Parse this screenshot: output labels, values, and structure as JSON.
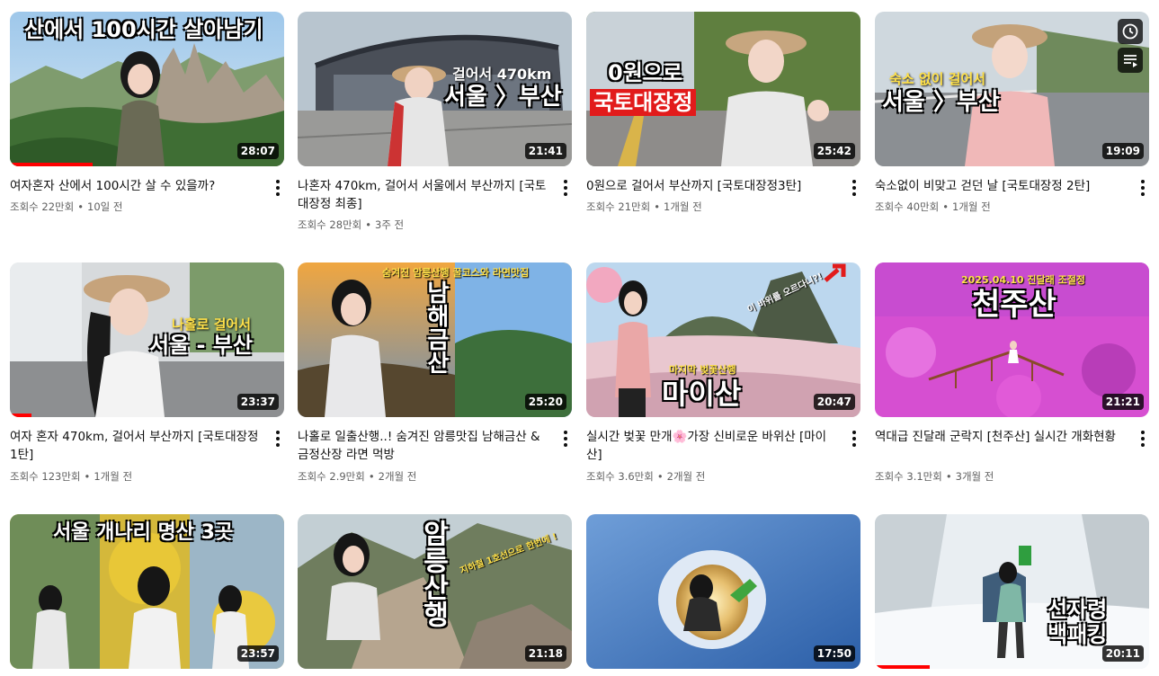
{
  "videos": [
    {
      "title": "여자혼자 산에서 100시간 살 수 있을까?",
      "views": "조회수 22만회",
      "age": "10일 전",
      "duration": "28:07",
      "overlay": [
        "산에서 100시간 살아남기"
      ],
      "progress": 0.3
    },
    {
      "title": "나혼자 470km, 걸어서 서울에서 부산까지 [국토대장정 최종]",
      "views": "조회수 28만회",
      "age": "3주 전",
      "duration": "21:41",
      "overlay": [
        "걸어서 470km",
        "서울 〉부산"
      ],
      "progress": 0
    },
    {
      "title": "0원으로 걸어서 부산까지 [국토대장정3탄]",
      "views": "조회수 21만회",
      "age": "1개월 전",
      "duration": "25:42",
      "overlay": [
        "0원으로",
        "국토대장정"
      ],
      "progress": 0
    },
    {
      "title": "숙소없이 비맞고 걷던 날 [국토대장정 2탄]",
      "views": "조회수 40만회",
      "age": "1개월 전",
      "duration": "19:09",
      "overlay": [
        "숙소 없이 걸어서",
        "서울 〉부산"
      ],
      "progress": 0
    },
    {
      "title": "여자 혼자 470km, 걸어서 부산까지 [국토대장정 1탄]",
      "views": "조회수 123만회",
      "age": "1개월 전",
      "duration": "23:37",
      "overlay": [
        "나홀로 걸어서",
        "서울 - 부산"
      ],
      "progress": 0.08
    },
    {
      "title": "나홀로 일출산행..! 숨겨진 암릉맛집 남해금산 & 금정산장 라면 먹방",
      "views": "조회수 2.9만회",
      "age": "2개월 전",
      "duration": "25:20",
      "overlay": [
        "숨겨진 암릉산행 꿀코스와 라면맛집",
        "남해금산"
      ],
      "progress": 0
    },
    {
      "title": "실시간 벚꽃 만개🌸가장 신비로운 바위산 [마이산]",
      "views": "조회수 3.6만회",
      "age": "2개월 전",
      "duration": "20:47",
      "overlay": [
        "마이산",
        "마지막 벚꽃산행",
        "이 바위를 오르다니?!"
      ],
      "progress": 0
    },
    {
      "title": "역대급 진달래 군락지 [천주산] 실시간 개화현황",
      "views": "조회수 3.1만회",
      "age": "3개월 전",
      "duration": "21:21",
      "overlay": [
        "천주산",
        "2025.04.10 진달래 조절정"
      ],
      "progress": 0
    },
    {
      "title": "",
      "views": "",
      "age": "",
      "duration": "23:57",
      "overlay": [
        "서울 개나리 명산 3곳"
      ],
      "progress": 0
    },
    {
      "title": "",
      "views": "",
      "age": "",
      "duration": "21:18",
      "overlay": [
        "암릉산행",
        "지하철 1호선으로 한번에 !"
      ],
      "progress": 0
    },
    {
      "title": "",
      "views": "",
      "age": "",
      "duration": "17:50",
      "overlay": [],
      "progress": 0
    },
    {
      "title": "",
      "views": "",
      "age": "",
      "duration": "20:11",
      "overlay": [
        "선자령",
        "백패킹"
      ],
      "progress": 0.2
    }
  ],
  "hover_actions": {
    "watch_later_icon": "clock-icon",
    "add_to_queue_icon": "queue-icon"
  },
  "colors": {
    "progress": "#ff0000",
    "meta_text": "#606060"
  }
}
